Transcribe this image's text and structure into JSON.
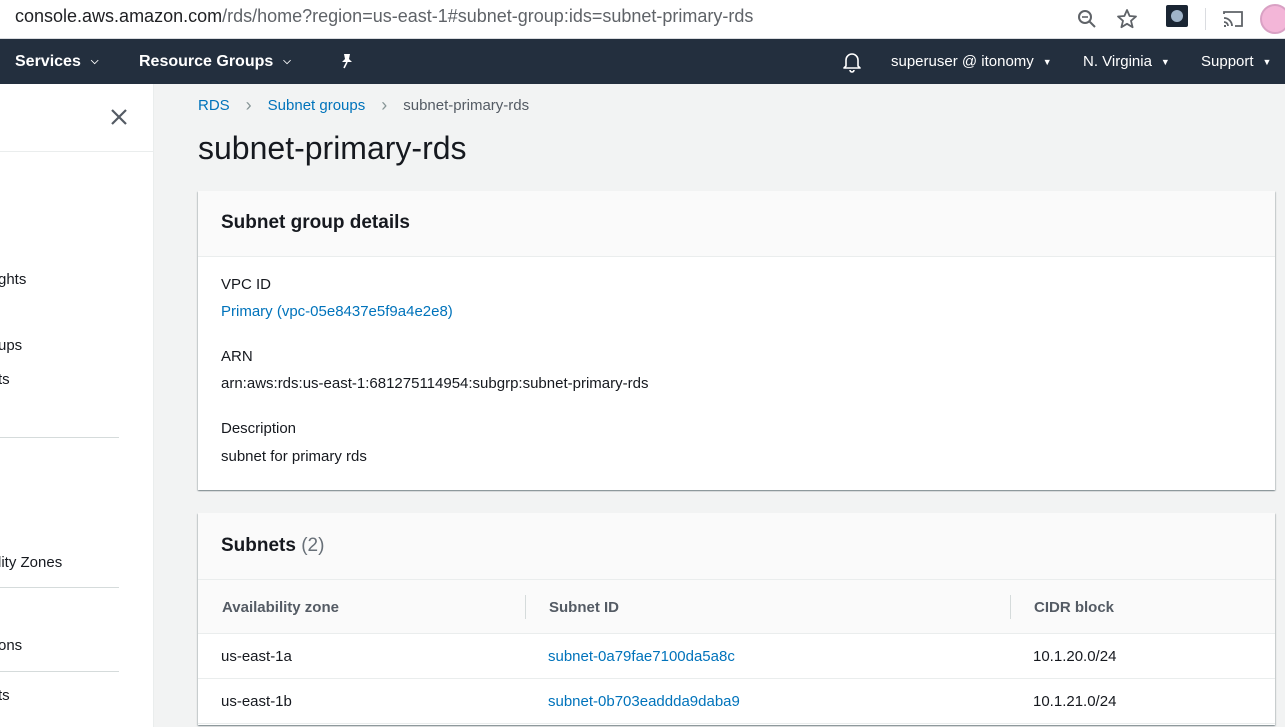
{
  "browser": {
    "url_host": "console.aws.amazon.com",
    "url_path": "/rds/home?region=us-east-1#subnet-group:ids=subnet-primary-rds",
    "icons": [
      "zoom-icon",
      "star-icon",
      "extension-icon",
      "cast-icon",
      "profile-avatar"
    ]
  },
  "topnav": {
    "services": "Services",
    "resource_groups": "Resource Groups",
    "user": "superuser @ itonomy",
    "region": "N. Virginia",
    "support": "Support",
    "icons": [
      "pin-icon",
      "bell-icon"
    ]
  },
  "sidebar": {
    "items": [
      "ghts",
      "ups",
      "ts",
      "lity Zones",
      "ons",
      "ts"
    ]
  },
  "breadcrumb": {
    "items": [
      "RDS",
      "Subnet groups"
    ],
    "current": "subnet-primary-rds"
  },
  "page_title": "subnet-primary-rds",
  "details": {
    "title": "Subnet group details",
    "vpc_label": "VPC ID",
    "vpc_value": "Primary (vpc-05e8437e5f9a4e2e8)",
    "arn_label": "ARN",
    "arn_value": "arn:aws:rds:us-east-1:681275114954:subgrp:subnet-primary-rds",
    "desc_label": "Description",
    "desc_value": "subnet for primary rds"
  },
  "subnets": {
    "title": "Subnets",
    "count": "(2)",
    "columns": [
      "Availability zone",
      "Subnet ID",
      "CIDR block"
    ],
    "rows": [
      {
        "az": "us-east-1a",
        "subnet_id": "subnet-0a79fae7100da5a8c",
        "cidr": "10.1.20.0/24"
      },
      {
        "az": "us-east-1b",
        "subnet_id": "subnet-0b703eaddda9daba9",
        "cidr": "10.1.21.0/24"
      }
    ]
  },
  "colors": {
    "nav_bg": "#232f3e",
    "link": "#0073bb",
    "page_bg": "#f2f3f3"
  }
}
